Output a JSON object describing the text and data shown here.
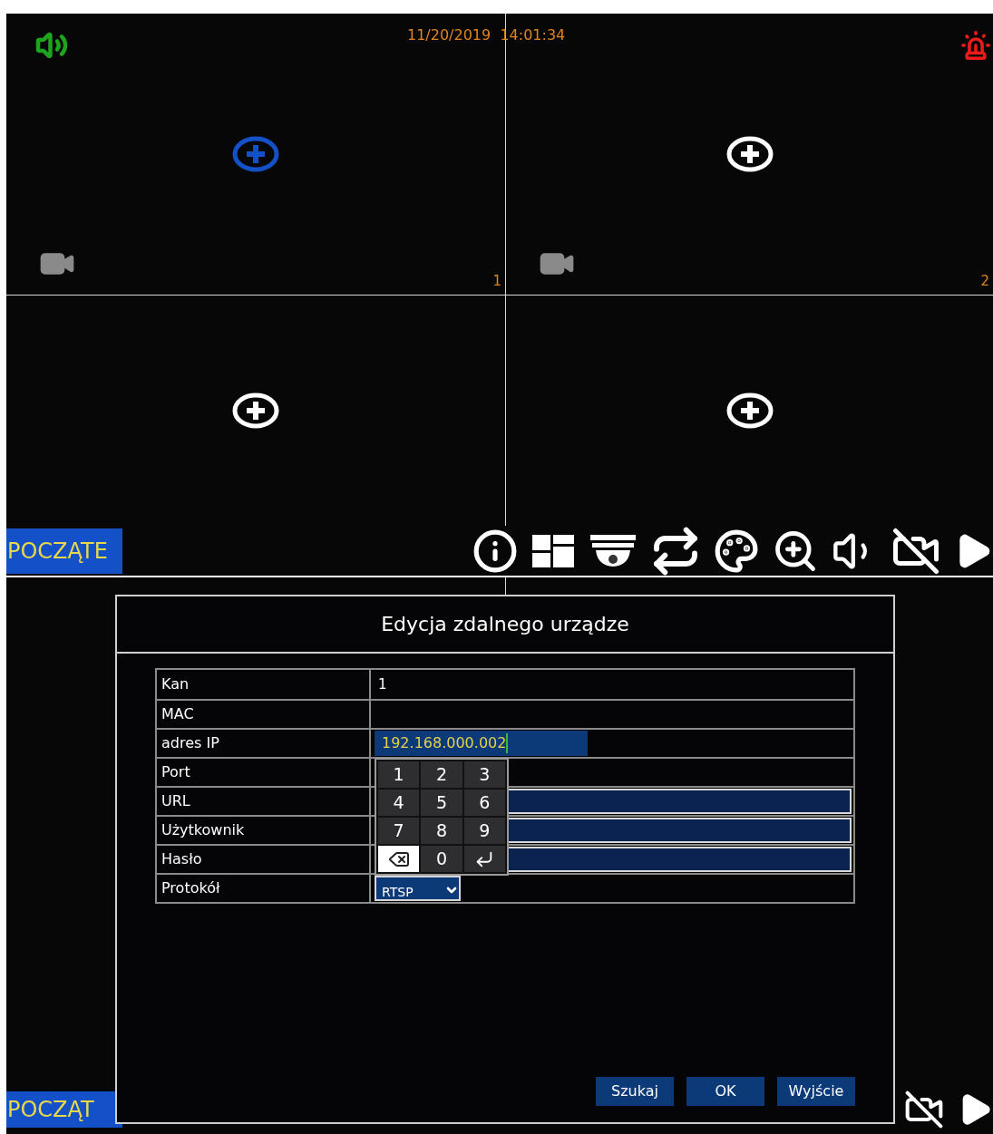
{
  "top_screen": {
    "datetime": "11/20/2019  14:01:34",
    "channels": [
      {
        "number": "1",
        "selected": true
      },
      {
        "number": "2",
        "selected": false
      },
      {
        "selected": false
      },
      {
        "selected": false
      }
    ],
    "start_button": "POCZĄTE"
  },
  "bottom_screen": {
    "start_button": "POCZĄT",
    "dialog": {
      "title": "Edycja zdalnego urządze",
      "fields": [
        {
          "label": "Kan",
          "kind": "text",
          "value": "1"
        },
        {
          "label": "MAC",
          "kind": "text"
        },
        {
          "label": "adres IP",
          "kind": "input",
          "value": "192.168.000.002"
        },
        {
          "label": "Port",
          "kind": "text"
        },
        {
          "label": "URL",
          "kind": "input"
        },
        {
          "label": "Użytkownik",
          "kind": "input"
        },
        {
          "label": "Hasło",
          "kind": "input"
        },
        {
          "label": "Protokół",
          "kind": "select",
          "value": "RTSP"
        }
      ],
      "keypad": [
        {
          "kind": "digit",
          "label": "1",
          "selected": false
        },
        {
          "kind": "digit",
          "label": "2",
          "selected": false
        },
        {
          "kind": "digit",
          "label": "3",
          "selected": false
        },
        {
          "kind": "digit",
          "label": "4",
          "selected": false
        },
        {
          "kind": "digit",
          "label": "5",
          "selected": false
        },
        {
          "kind": "digit",
          "label": "6",
          "selected": false
        },
        {
          "kind": "digit",
          "label": "7",
          "selected": false
        },
        {
          "kind": "digit",
          "label": "8",
          "selected": false
        },
        {
          "kind": "digit",
          "label": "9",
          "selected": false
        },
        {
          "kind": "backspace",
          "selected": true
        },
        {
          "kind": "digit",
          "label": "0",
          "selected": false
        },
        {
          "kind": "enter",
          "selected": false
        }
      ],
      "buttons": [
        "Szukaj",
        "OK",
        "Wyjście"
      ]
    }
  }
}
